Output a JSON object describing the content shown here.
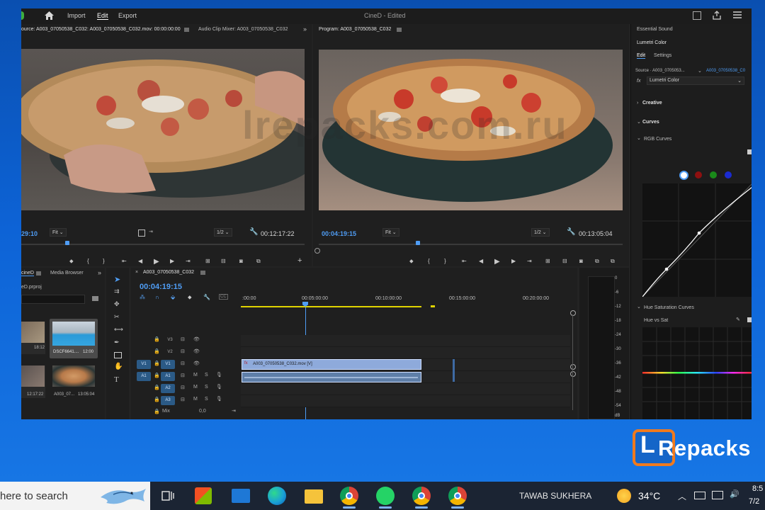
{
  "app": {
    "title": "CineD",
    "title_status": " - Edited",
    "menu": [
      "Import",
      "Edit",
      "Export"
    ],
    "active_menu": "Edit"
  },
  "source": {
    "tab_label": "ource: A003_07050538_C032: A003_07050538_C032.mov: 00:00:00:00",
    "mixer_tab": "Audio Clip Mixer: A003_07050538_C032",
    "timecode": "29:10",
    "fit": "Fit",
    "res": "1/2",
    "duration": "00:12:17:22"
  },
  "program": {
    "tab_label": "Program: A003_07050538_C032",
    "timecode": "00:04:19:15",
    "fit": "Fit",
    "res": "1/2",
    "duration": "00:13:05:04"
  },
  "lumetri": {
    "essential": "Essential Sound",
    "title": "Lumetri Color",
    "tabs": [
      "Edit",
      "Settings"
    ],
    "source_label": "Source · A003_0705053...",
    "source_clip": "A003_07050538_C0",
    "fx_label": "Lumetri Color",
    "sections": [
      "Creative",
      "Curves"
    ],
    "rgb_curves": "RGB Curves",
    "hue_sat_curves": "Hue Saturation Curves",
    "hue_vs_sat": "Hue vs Sat",
    "channel_colors": [
      "#ffffff",
      "#8e1010",
      "#1a8a1a",
      "#1a2bd0"
    ]
  },
  "project": {
    "tab1": "cineD",
    "tab2": "Media Browser",
    "file": "eD.prproj",
    "items": [
      {
        "name": "",
        "dur": "18:12"
      },
      {
        "name": "DSCF6641....",
        "dur": "12:00"
      },
      {
        "name": "",
        "dur": "12:17:22"
      },
      {
        "name": "A003_07...",
        "dur": "13:05:04"
      }
    ]
  },
  "timeline": {
    "tab": "A003_07050538_C032",
    "timecode": "00:04:19:15",
    "ruler": [
      ":00:00",
      "00:05:00:00",
      "00:10:00:00",
      "00:15:00:00",
      "00:20:00:00"
    ],
    "tracks_video": [
      {
        "label": "V3",
        "src": ""
      },
      {
        "label": "V2",
        "src": ""
      },
      {
        "label": "V1",
        "src": "V1"
      }
    ],
    "tracks_audio": [
      {
        "label": "A1",
        "src": "A1"
      },
      {
        "label": "A2",
        "src": ""
      },
      {
        "label": "A3",
        "src": ""
      }
    ],
    "mix_label": "Mix",
    "mix_value": "0,0",
    "clip_label": "A003_07050538_C032.mov [V]",
    "meter": [
      "0",
      "-6",
      "-12",
      "-18",
      "-24",
      "-30",
      "-36",
      "-42",
      "-48",
      "-54",
      "dB"
    ]
  },
  "watermark": "lrepacks.com.ru",
  "logo": {
    "letter": "L",
    "text": "Repacks"
  },
  "taskbar": {
    "search_placeholder": "here to search",
    "user": "TAWAB SUKHERA",
    "temp": "34°C",
    "time": "8:5",
    "date": "7/2"
  }
}
